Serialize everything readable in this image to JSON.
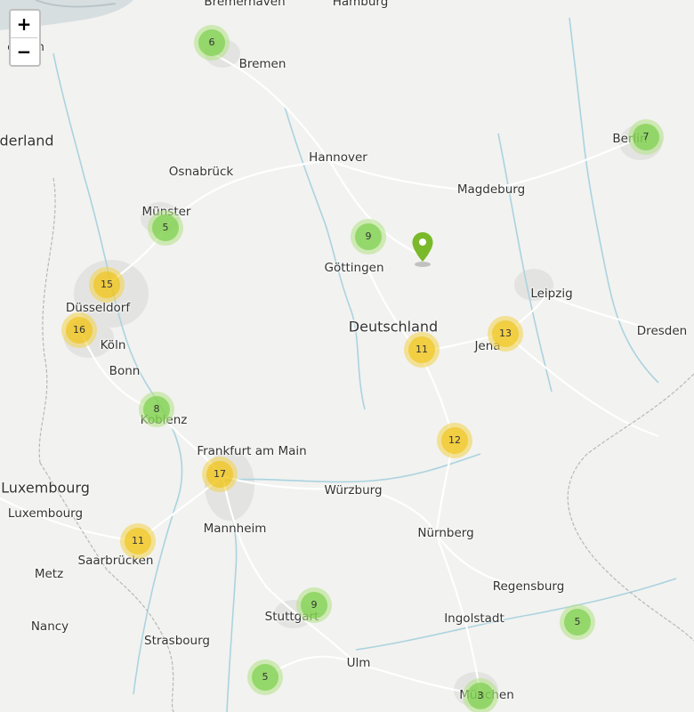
{
  "map": {
    "zoom_controls": {
      "zoom_in": "+",
      "zoom_out": "−"
    },
    "country_labels": [
      {
        "id": "deutschland",
        "text": "Deutschland"
      },
      {
        "id": "nederland",
        "text": "derland"
      },
      {
        "id": "luxembourg-country",
        "text": "Luxembourg"
      }
    ],
    "city_labels": [
      {
        "id": "bremerhaven",
        "text": "Bremerhaven"
      },
      {
        "id": "hamburg",
        "text": "Hamburg"
      },
      {
        "id": "emden",
        "text": "eu  len"
      },
      {
        "id": "bremen",
        "text": "Bremen"
      },
      {
        "id": "berlin",
        "text": "Berlin"
      },
      {
        "id": "hannover",
        "text": "Hannover"
      },
      {
        "id": "osnabrueck",
        "text": "Osnabrück"
      },
      {
        "id": "magdeburg",
        "text": "Magdeburg"
      },
      {
        "id": "muenster",
        "text": "Münster"
      },
      {
        "id": "goettingen",
        "text": "Göttingen"
      },
      {
        "id": "leipzig",
        "text": "Leipzig"
      },
      {
        "id": "duesseldorf",
        "text": "Düsseldorf"
      },
      {
        "id": "dresden",
        "text": "Dresden"
      },
      {
        "id": "jena",
        "text": "Jena"
      },
      {
        "id": "koeln",
        "text": "Köln"
      },
      {
        "id": "bonn",
        "text": "Bonn"
      },
      {
        "id": "koblenz",
        "text": "Koblenz"
      },
      {
        "id": "frankfurt",
        "text": "Frankfurt am Main"
      },
      {
        "id": "wuerzburg",
        "text": "Würzburg"
      },
      {
        "id": "luxembourg-city",
        "text": "Luxembourg"
      },
      {
        "id": "mannheim",
        "text": "Mannheim"
      },
      {
        "id": "nuernberg",
        "text": "Nürnberg"
      },
      {
        "id": "saarbruecken",
        "text": "Saarbrücken"
      },
      {
        "id": "metz",
        "text": "Metz"
      },
      {
        "id": "regensburg",
        "text": "Regensburg"
      },
      {
        "id": "stuttgart",
        "text": "Stuttgart"
      },
      {
        "id": "ingolstadt",
        "text": "Ingolstadt"
      },
      {
        "id": "nancy",
        "text": "Nancy"
      },
      {
        "id": "strasbourg",
        "text": "Strasbourg"
      },
      {
        "id": "ulm",
        "text": "Ulm"
      },
      {
        "id": "muenchen",
        "text": "München"
      }
    ],
    "clusters": [
      {
        "id": "bremen-area",
        "count": "6",
        "level": "small"
      },
      {
        "id": "berlin-area",
        "count": "7",
        "level": "small"
      },
      {
        "id": "muenster-area",
        "count": "5",
        "level": "small"
      },
      {
        "id": "goettingen-area",
        "count": "9",
        "level": "small"
      },
      {
        "id": "duesseldorf-area",
        "count": "15",
        "level": "medium"
      },
      {
        "id": "koeln-area",
        "count": "16",
        "level": "medium"
      },
      {
        "id": "thuringia-area",
        "count": "11",
        "level": "medium"
      },
      {
        "id": "jena-area",
        "count": "13",
        "level": "medium"
      },
      {
        "id": "koblenz-area",
        "count": "8",
        "level": "small"
      },
      {
        "id": "franconia-area",
        "count": "12",
        "level": "medium"
      },
      {
        "id": "frankfurt-area",
        "count": "17",
        "level": "medium"
      },
      {
        "id": "saarbruecken-area",
        "count": "11",
        "level": "medium"
      },
      {
        "id": "stuttgart-area",
        "count": "9",
        "level": "small"
      },
      {
        "id": "lower-bavaria-area",
        "count": "5",
        "level": "small"
      },
      {
        "id": "swabia-area",
        "count": "5",
        "level": "small"
      },
      {
        "id": "muenchen-area",
        "count": "3",
        "level": "small"
      }
    ],
    "marker": {
      "name": "location-marker",
      "color": "#7ab929"
    },
    "colors": {
      "land": "#f2f2f0",
      "water": "#aad3df",
      "roads": "#ffffff",
      "cluster_small": "#6ecc39",
      "cluster_medium": "#f0c20c"
    }
  }
}
